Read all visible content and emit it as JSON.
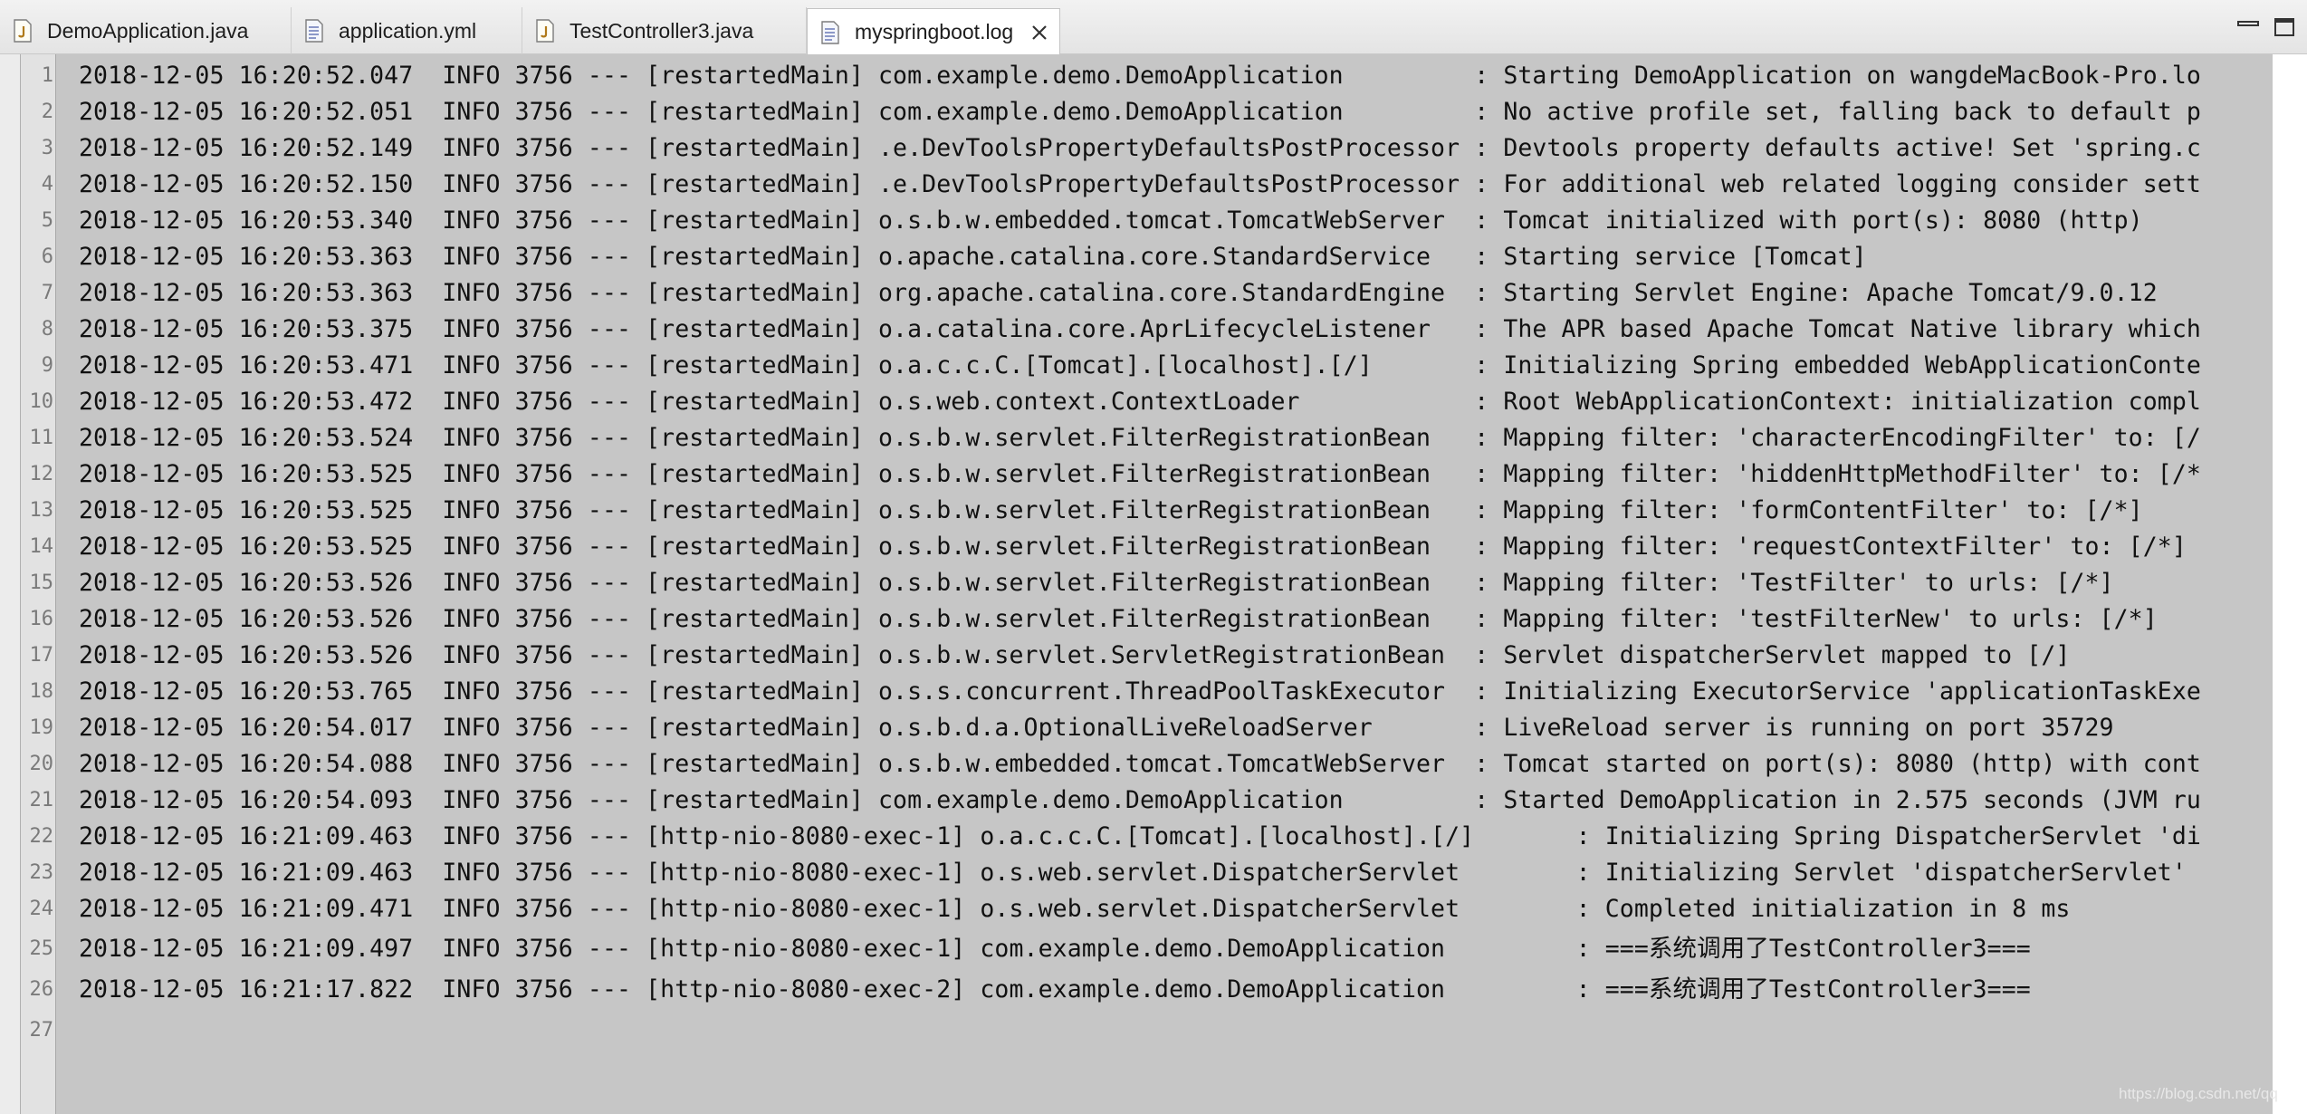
{
  "tabs": [
    {
      "label": "DemoApplication.java",
      "icon": "java-file-icon"
    },
    {
      "label": "application.yml",
      "icon": "text-file-icon"
    },
    {
      "label": "TestController3.java",
      "icon": "java-file-icon"
    },
    {
      "label": "myspringboot.log",
      "icon": "text-file-icon",
      "active": true
    }
  ],
  "window_controls": {
    "minimize": "minimize-icon",
    "maximize": "maximize-icon"
  },
  "editor": {
    "line_numbers": [
      "1",
      "2",
      "3",
      "4",
      "5",
      "6",
      "7",
      "8",
      "9",
      "10",
      "11",
      "12",
      "13",
      "14",
      "15",
      "16",
      "17",
      "18",
      "19",
      "20",
      "21",
      "22",
      "23",
      "24",
      "25",
      "26",
      "27"
    ],
    "lines": [
      "2018-12-05 16:20:52.047  INFO 3756 --- [restartedMain] com.example.demo.DemoApplication         : Starting DemoApplication on wangdeMacBook-Pro.lo",
      "2018-12-05 16:20:52.051  INFO 3756 --- [restartedMain] com.example.demo.DemoApplication         : No active profile set, falling back to default p",
      "2018-12-05 16:20:52.149  INFO 3756 --- [restartedMain] .e.DevToolsPropertyDefaultsPostProcessor : Devtools property defaults active! Set 'spring.c",
      "2018-12-05 16:20:52.150  INFO 3756 --- [restartedMain] .e.DevToolsPropertyDefaultsPostProcessor : For additional web related logging consider sett",
      "2018-12-05 16:20:53.340  INFO 3756 --- [restartedMain] o.s.b.w.embedded.tomcat.TomcatWebServer  : Tomcat initialized with port(s): 8080 (http)",
      "2018-12-05 16:20:53.363  INFO 3756 --- [restartedMain] o.apache.catalina.core.StandardService   : Starting service [Tomcat]",
      "2018-12-05 16:20:53.363  INFO 3756 --- [restartedMain] org.apache.catalina.core.StandardEngine  : Starting Servlet Engine: Apache Tomcat/9.0.12",
      "2018-12-05 16:20:53.375  INFO 3756 --- [restartedMain] o.a.catalina.core.AprLifecycleListener   : The APR based Apache Tomcat Native library which",
      "2018-12-05 16:20:53.471  INFO 3756 --- [restartedMain] o.a.c.c.C.[Tomcat].[localhost].[/]       : Initializing Spring embedded WebApplicationConte",
      "2018-12-05 16:20:53.472  INFO 3756 --- [restartedMain] o.s.web.context.ContextLoader            : Root WebApplicationContext: initialization compl",
      "2018-12-05 16:20:53.524  INFO 3756 --- [restartedMain] o.s.b.w.servlet.FilterRegistrationBean   : Mapping filter: 'characterEncodingFilter' to: [/",
      "2018-12-05 16:20:53.525  INFO 3756 --- [restartedMain] o.s.b.w.servlet.FilterRegistrationBean   : Mapping filter: 'hiddenHttpMethodFilter' to: [/*",
      "2018-12-05 16:20:53.525  INFO 3756 --- [restartedMain] o.s.b.w.servlet.FilterRegistrationBean   : Mapping filter: 'formContentFilter' to: [/*]",
      "2018-12-05 16:20:53.525  INFO 3756 --- [restartedMain] o.s.b.w.servlet.FilterRegistrationBean   : Mapping filter: 'requestContextFilter' to: [/*]",
      "2018-12-05 16:20:53.526  INFO 3756 --- [restartedMain] o.s.b.w.servlet.FilterRegistrationBean   : Mapping filter: 'TestFilter' to urls: [/*]",
      "2018-12-05 16:20:53.526  INFO 3756 --- [restartedMain] o.s.b.w.servlet.FilterRegistrationBean   : Mapping filter: 'testFilterNew' to urls: [/*]",
      "2018-12-05 16:20:53.526  INFO 3756 --- [restartedMain] o.s.b.w.servlet.ServletRegistrationBean  : Servlet dispatcherServlet mapped to [/]",
      "2018-12-05 16:20:53.765  INFO 3756 --- [restartedMain] o.s.s.concurrent.ThreadPoolTaskExecutor  : Initializing ExecutorService 'applicationTaskExe",
      "2018-12-05 16:20:54.017  INFO 3756 --- [restartedMain] o.s.b.d.a.OptionalLiveReloadServer       : LiveReload server is running on port 35729",
      "2018-12-05 16:20:54.088  INFO 3756 --- [restartedMain] o.s.b.w.embedded.tomcat.TomcatWebServer  : Tomcat started on port(s): 8080 (http) with cont",
      "2018-12-05 16:20:54.093  INFO 3756 --- [restartedMain] com.example.demo.DemoApplication         : Started DemoApplication in 2.575 seconds (JVM ru",
      "2018-12-05 16:21:09.463  INFO 3756 --- [http-nio-8080-exec-1] o.a.c.c.C.[Tomcat].[localhost].[/]       : Initializing Spring DispatcherServlet 'di",
      "2018-12-05 16:21:09.463  INFO 3756 --- [http-nio-8080-exec-1] o.s.web.servlet.DispatcherServlet        : Initializing Servlet 'dispatcherServlet'",
      "2018-12-05 16:21:09.471  INFO 3756 --- [http-nio-8080-exec-1] o.s.web.servlet.DispatcherServlet        : Completed initialization in 8 ms",
      "2018-12-05 16:21:09.497  INFO 3756 --- [http-nio-8080-exec-1] com.example.demo.DemoApplication         : ===系统调用了TestController3===",
      "2018-12-05 16:21:17.822  INFO 3756 --- [http-nio-8080-exec-2] com.example.demo.DemoApplication         : ===系统调用了TestController3===",
      ""
    ]
  },
  "watermark": "https://blog.csdn.net/qq"
}
